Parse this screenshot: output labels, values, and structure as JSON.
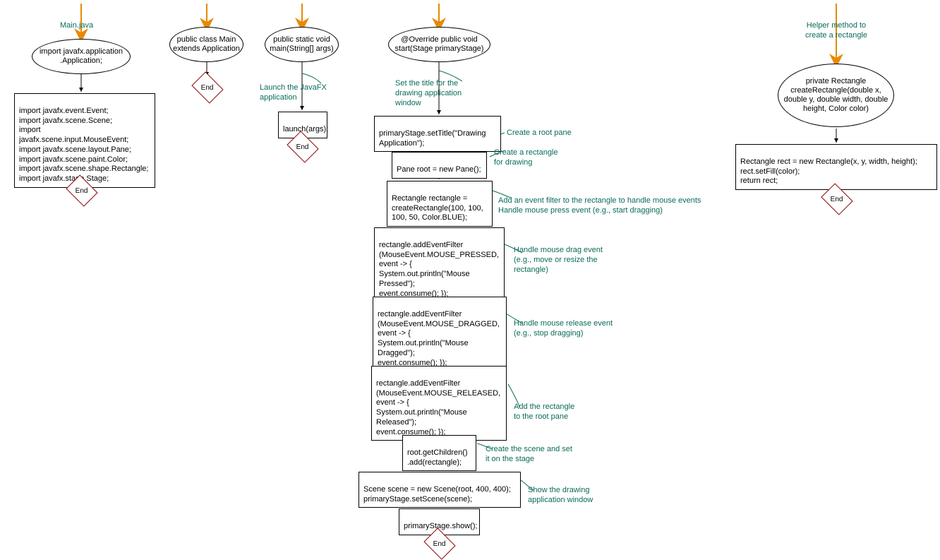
{
  "col1": {
    "startComment": "Main.java",
    "n1": "import javafx.application\n.Application;",
    "n2": "import javafx.event.Event;\nimport javafx.scene.Scene;\nimport javafx.scene.input.MouseEvent;\nimport javafx.scene.layout.Pane;\nimport javafx.scene.paint.Color;\nimport javafx.scene.shape.Rectangle;\nimport javafx.stage.Stage;",
    "end": "End"
  },
  "col2": {
    "n1": "public class Main\nextends Application",
    "end": "End"
  },
  "col3": {
    "n1": "public static void\nmain(String[] args)",
    "c1": "Launch the JavaFX\napplication",
    "n2": "launch(args);",
    "end": "End"
  },
  "col4": {
    "n1": "@Override public void\nstart(Stage primaryStage)",
    "c1": "Set the title for the\ndrawing application\nwindow",
    "n2": "primaryStage.setTitle(\"Drawing\nApplication\");",
    "c2": "Create a root pane",
    "n3": "Pane root = new Pane();",
    "c3": "Create a rectangle\nfor drawing",
    "n4": "Rectangle rectangle =\ncreateRectangle(100, 100,\n100, 50, Color.BLUE);",
    "c4": "Add an event filter to the rectangle to handle mouse events\nHandle mouse press event (e.g., start dragging)",
    "n5": "rectangle.addEventFilter\n(MouseEvent.MOUSE_PRESSED,\nevent -> {\nSystem.out.println(\"Mouse\nPressed\");\nevent.consume(); });",
    "c5": "Handle mouse drag event\n(e.g., move or resize the\nrectangle)",
    "n6": "rectangle.addEventFilter\n(MouseEvent.MOUSE_DRAGGED,\nevent -> {\nSystem.out.println(\"Mouse\nDragged\");\nevent.consume(); });",
    "c6": "Handle mouse release event\n(e.g., stop dragging)",
    "n7": "rectangle.addEventFilter\n(MouseEvent.MOUSE_RELEASED,\nevent -> {\nSystem.out.println(\"Mouse\nReleased\");\nevent.consume(); });",
    "c7": "Add the rectangle\nto the root pane",
    "n8": "root.getChildren()\n.add(rectangle);",
    "c8": "Create the scene and set\nit on the stage",
    "n9": "Scene scene = new Scene(root, 400, 400);\nprimaryStage.setScene(scene);",
    "c9": "Show the drawing\napplication window",
    "n10": "primaryStage.show();",
    "end": "End"
  },
  "col5": {
    "startComment": "Helper method to\ncreate a rectangle",
    "n1": "private Rectangle\ncreateRectangle(double x,\ndouble y, double width,\ndouble height, Color\ncolor)",
    "n2": "Rectangle rect = new Rectangle(x, y, width, height);\nrect.setFill(color);\nreturn rect;",
    "end": "End"
  }
}
